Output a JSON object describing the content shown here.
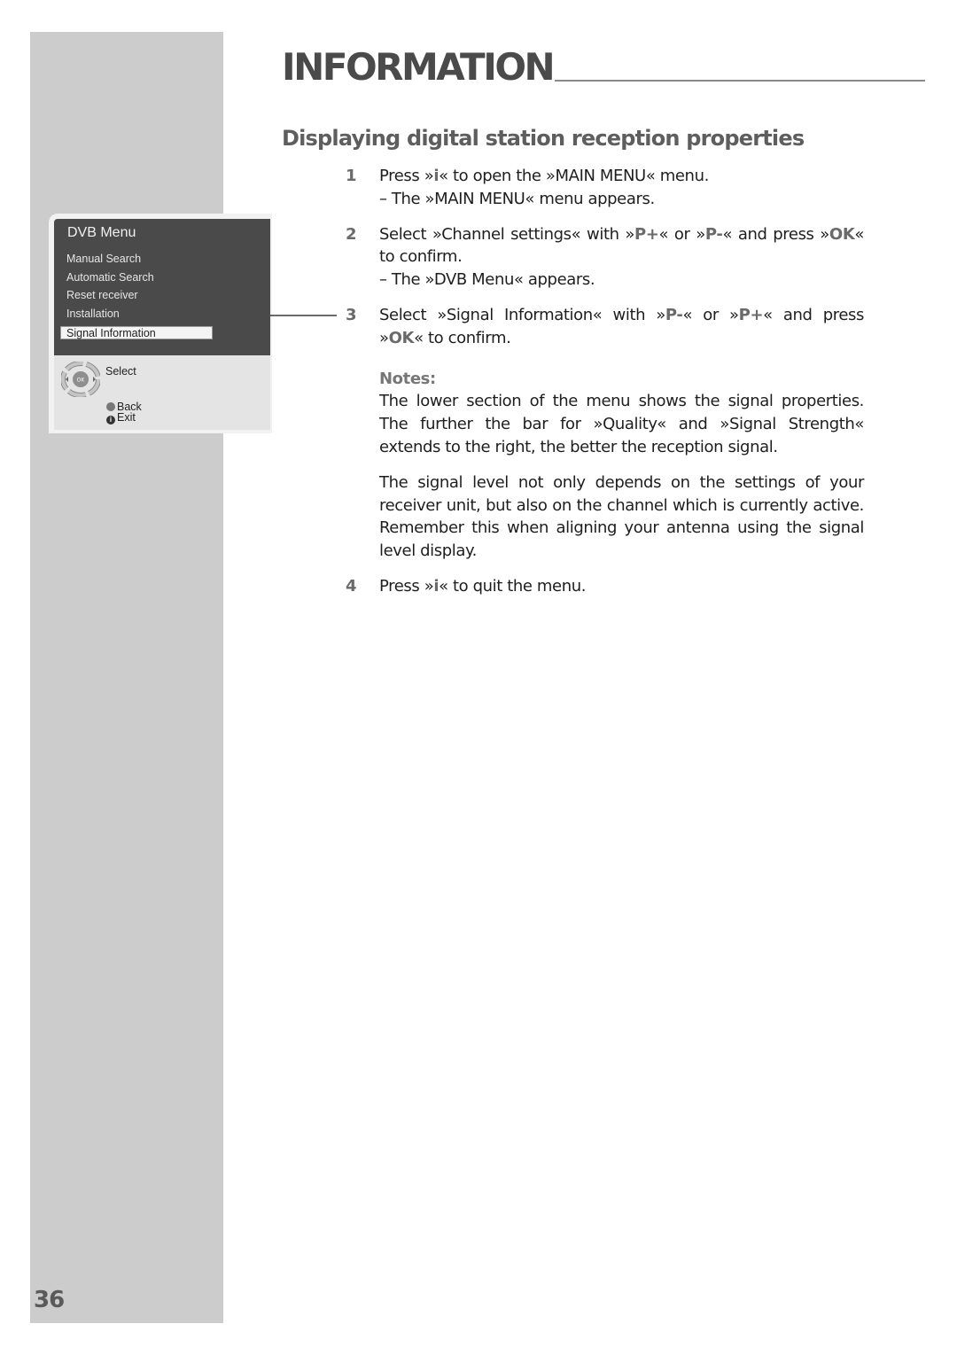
{
  "header": {
    "title": "INFORMATION"
  },
  "section_title": "Displaying digital station reception properties",
  "steps": [
    {
      "num": "1",
      "parts": [
        "Press »",
        "i",
        "« to open the »MAIN MENU« menu."
      ],
      "sub": "– The »MAIN MENU« menu appears."
    },
    {
      "num": "2",
      "parts": [
        "Select »Channel settings« with »",
        "P+",
        "« or »",
        "P-",
        "« and press »",
        "OK",
        "« to confirm."
      ],
      "sub": "– The »DVB Menu« appears."
    },
    {
      "num": "3",
      "parts": [
        "Select »Signal Information« with »",
        "P-",
        "« or »",
        "P+",
        "« and press »",
        "OK",
        "« to confirm."
      ]
    },
    {
      "num": "4",
      "parts": [
        "Press »",
        "i",
        "« to quit the menu."
      ]
    }
  ],
  "notes": {
    "title": "Notes:",
    "paragraphs": [
      "The lower section of the menu shows the signal properties. The further the bar for »Quality« and »Signal Strength« extends to the right, the better the reception signal.",
      "The signal level not only depends on the settings of your receiver unit, but also on the channel which is currently active. Remember this when aligning your antenna using the signal level display."
    ]
  },
  "dvb_menu": {
    "title": "DVB Menu",
    "items": [
      {
        "label": "Manual Search",
        "selected": false
      },
      {
        "label": "Automatic Search",
        "selected": false
      },
      {
        "label": "Reset receiver",
        "selected": false
      },
      {
        "label": "Installation",
        "selected": false
      },
      {
        "label": "Signal Information",
        "selected": true
      }
    ],
    "hints": {
      "select": "Select",
      "back": "Back",
      "exit": "Exit",
      "ok_key": "OK",
      "p_plus": "P+",
      "p_minus": "P-"
    }
  },
  "page_number": "36"
}
